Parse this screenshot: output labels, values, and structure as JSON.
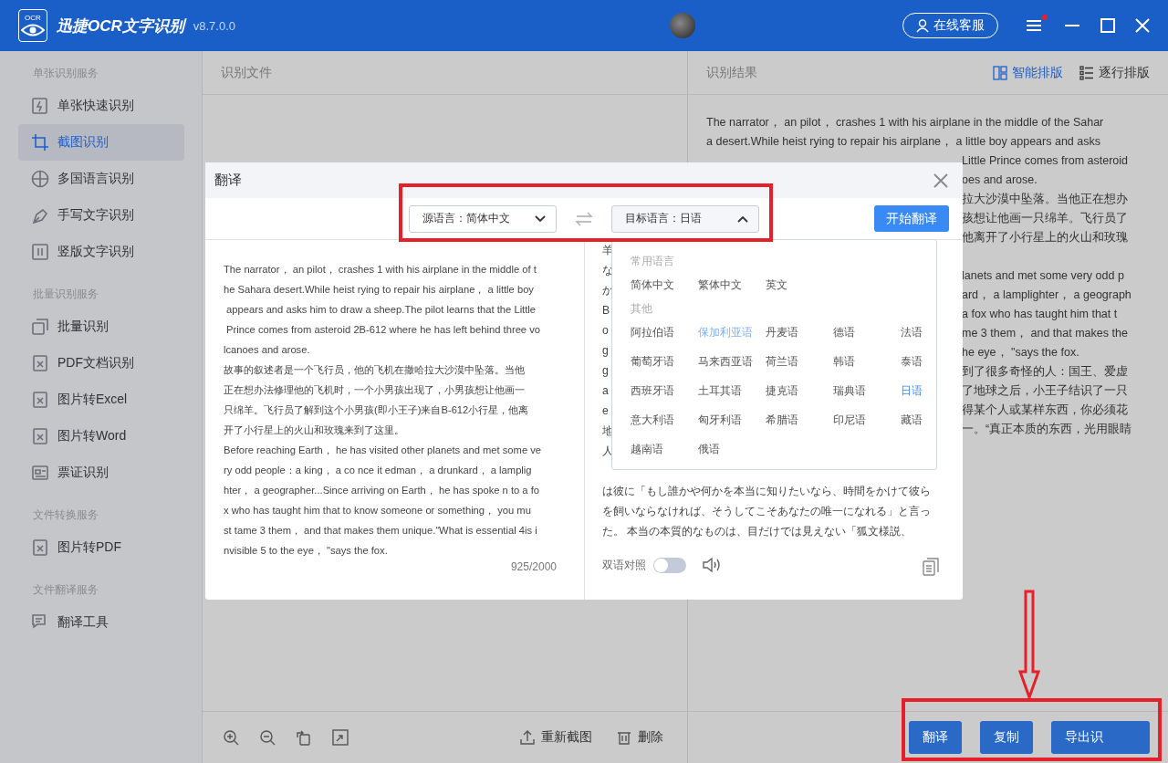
{
  "title_bar": {
    "logo_text": "OCR",
    "app_name": "迅捷OCR文字识别",
    "version": "v8.7.0.0",
    "service_button": "在线客服",
    "menu_badge": true
  },
  "sidebar": {
    "sections": [
      {
        "heading": "单张识别服务",
        "items": [
          {
            "label": "单张快速识别",
            "kind": "bolt",
            "selected": false
          },
          {
            "label": "截图识别",
            "kind": "crop",
            "selected": true
          },
          {
            "label": "多国语言识别",
            "kind": "globe",
            "selected": false
          },
          {
            "label": "手写文字识别",
            "kind": "pen",
            "selected": false
          },
          {
            "label": "竖版文字识别",
            "kind": "columns",
            "selected": false
          }
        ]
      },
      {
        "heading": "批量识别服务",
        "items": [
          {
            "label": "批量识别",
            "kind": "stack",
            "selected": false
          },
          {
            "label": "PDF文档识别",
            "kind": "doc",
            "selected": false
          },
          {
            "label": "图片转Excel",
            "kind": "doc",
            "selected": false
          },
          {
            "label": "图片转Word",
            "kind": "doc",
            "selected": false
          },
          {
            "label": "票证识别",
            "kind": "card",
            "selected": false
          }
        ]
      },
      {
        "heading": "文件转换服务",
        "items": [
          {
            "label": "图片转PDF",
            "kind": "doc",
            "selected": false
          }
        ]
      },
      {
        "heading": "文件翻译服务",
        "items": [
          {
            "label": "翻译工具",
            "kind": "chat",
            "selected": false
          }
        ]
      }
    ]
  },
  "file_panel": {
    "title": "识别文件",
    "retake_button": "重新截图",
    "delete_button": "删除"
  },
  "result_panel": {
    "title": "识别结果",
    "layout_options": [
      {
        "label": "智能排版",
        "kind": "panels",
        "selected": true
      },
      {
        "label": "逐行排版",
        "kind": "list",
        "selected": false
      }
    ],
    "lines": [
      {
        "kind": "full",
        "text": "The narrator， an pilot， crashes 1 with his airplane in the middle of the Sahar"
      },
      {
        "kind": "full",
        "text": "a desert.While heist rying to repair his airplane， a little boy appears and asks"
      },
      {
        "kind": "fragment",
        "text": "Little Prince comes from asteroid"
      },
      {
        "kind": "fragment",
        "text": "oes and arose."
      },
      {
        "kind": "fragment",
        "text": "拉大沙漠中坠落。当他正在想办"
      },
      {
        "kind": "fragment",
        "text": "孩想让他画一只绵羊。飞行员了"
      },
      {
        "kind": "fragment",
        "text": "他离开了小行星上的火山和玫瑰"
      },
      {
        "kind": "hidden"
      },
      {
        "kind": "fragment",
        "text": "lanets and met some very odd p"
      },
      {
        "kind": "fragment",
        "text": "ard， a lamplighter， a geograph"
      },
      {
        "kind": "fragment",
        "text": "a fox who has taught him that t"
      },
      {
        "kind": "fragment",
        "text": "me 3 them， and that makes the"
      },
      {
        "kind": "fragment",
        "text": "he eye， \"says the fox."
      },
      {
        "kind": "fragment",
        "text": "到了很多奇怪的人：国王、爱虚"
      },
      {
        "kind": "fragment",
        "text": "了地球之后，小王子结识了一只"
      },
      {
        "kind": "fragment",
        "text": "得某个人或某样东西，你必须花"
      },
      {
        "kind": "fragment",
        "text": "一。“真正本质的东西，光用眼睛"
      }
    ],
    "actions": [
      "翻译",
      "复制",
      "导出识"
    ]
  },
  "dialog": {
    "title": "翻译",
    "source_select": "源语言：简体中文",
    "target_select": "目标语言：日语",
    "target_open": true,
    "start_button": "开始翻译",
    "source_lines": [
      "The narrator， an pilot， crashes 1 with his airplane in the middle of t",
      "he Sahara desert.While heist rying to repair his airplane， a little boy",
      " appears and asks him to draw a sheep.The pilot learns that the Little",
      " Prince comes from asteroid 2B-612 where he has left behind three vo",
      "lcanoes and arose.",
      "故事的叙述者是一个飞行员，他的飞机在撒哈拉大沙漠中坠落。当他",
      "正在想办法修理他的飞机时，一个小男孩出现了，小男孩想让他画一",
      "只绵羊。飞行员了解到这个小男孩(即小王子)来自B-612小行星，他离",
      "开了小行星上的火山和玫瑰来到了这里。",
      "Before reaching Earth， he has visited other planets and met some ve",
      "ry odd people：a king， a co nce it edman， a drunkard， a lamplig",
      "hter， a geographer...Since arriving on Earth， he has spoke n to a fo",
      "x who has taught him that to know someone or something， you mu",
      "st tame 3 them， and that makes them unique.“What is essential 4is i",
      "nvisible 5 to the eye， \"says the fox."
    ],
    "count": "925/2000",
    "result_lines": [
      {
        "kind": "text",
        "text": "羊"
      },
      {
        "kind": "text",
        "text": "な"
      },
      {
        "kind": "text",
        "text": "か"
      },
      {
        "kind": "text",
        "text": "B"
      },
      {
        "kind": "text",
        "text": "o"
      },
      {
        "kind": "text",
        "text": "g"
      },
      {
        "kind": "text",
        "text": "g"
      },
      {
        "kind": "text",
        "text": "a"
      },
      {
        "kind": "text",
        "text": "e"
      },
      {
        "kind": "text",
        "text": "地"
      },
      {
        "kind": "text",
        "text": "人"
      },
      {
        "kind": "gap"
      },
      {
        "kind": "text",
        "text": "は彼に「もし誰かや何かを本当に知りたいなら、時間をかけて彼ら"
      },
      {
        "kind": "text",
        "text": "を飼いならなければ、そうしてこそあなたの唯一になれる」と言っ"
      },
      {
        "kind": "text",
        "text": "た。 本当の本質的なものは、目だけでは見えない「狐文様説、"
      }
    ],
    "bilingual": {
      "label": "双语对照",
      "on": false
    },
    "dropdown": [
      {
        "heading": "常用语言",
        "items": [
          {
            "label": "简体中文",
            "selected": false,
            "hovered": false
          },
          {
            "label": "繁体中文",
            "selected": false,
            "hovered": false
          },
          {
            "label": "英文",
            "selected": false,
            "hovered": false
          }
        ]
      },
      {
        "heading": "其他",
        "items": [
          {
            "label": "阿拉伯语",
            "selected": false,
            "hovered": false
          },
          {
            "label": "保加利亚语",
            "selected": false,
            "hovered": true
          },
          {
            "label": "丹麦语",
            "selected": false,
            "hovered": false
          },
          {
            "label": "德语",
            "selected": false,
            "hovered": false
          },
          {
            "label": "法语",
            "selected": false,
            "hovered": false
          },
          {
            "label": "葡萄牙语",
            "selected": false,
            "hovered": false
          },
          {
            "label": "马来西亚语",
            "selected": false,
            "hovered": false
          },
          {
            "label": "荷兰语",
            "selected": false,
            "hovered": false
          },
          {
            "label": "韩语",
            "selected": false,
            "hovered": false
          },
          {
            "label": "泰语",
            "selected": false,
            "hovered": false
          },
          {
            "label": "西班牙语",
            "selected": false,
            "hovered": false
          },
          {
            "label": "土耳其语",
            "selected": false,
            "hovered": false
          },
          {
            "label": "捷克语",
            "selected": false,
            "hovered": false
          },
          {
            "label": "瑞典语",
            "selected": false,
            "hovered": false
          },
          {
            "label": "日语",
            "selected": true,
            "hovered": false
          },
          {
            "label": "意大利语",
            "selected": false,
            "hovered": false
          },
          {
            "label": "匈牙利语",
            "selected": false,
            "hovered": false
          },
          {
            "label": "希腊语",
            "selected": false,
            "hovered": false
          },
          {
            "label": "印尼语",
            "selected": false,
            "hovered": false
          },
          {
            "label": "藏语",
            "selected": false,
            "hovered": false
          },
          {
            "label": "越南语",
            "selected": false,
            "hovered": false
          },
          {
            "label": "俄语",
            "selected": false,
            "hovered": false
          }
        ]
      }
    ]
  }
}
